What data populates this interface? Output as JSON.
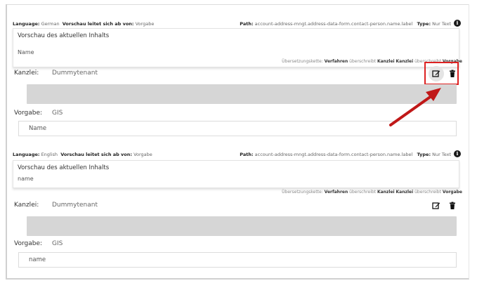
{
  "entries": [
    {
      "meta": {
        "language_label": "Language:",
        "language_value": "German",
        "redirect_label": "Vorschau leitet sich ab von:",
        "redirect_value": "Vorgabe",
        "path_label": "Path:",
        "path_value": "account-address-mngt.address-data-form.contact-person.name.label",
        "type_label": "Type:",
        "type_value": "Nur Text"
      },
      "preview": {
        "title": "Vorschau des aktuellen Inhalts",
        "value": "Name"
      },
      "chain": {
        "prefix": "Übersetzungskette:",
        "a": "Verfahren",
        "mid1": "überschreibt",
        "b": "Kanzlei",
        "c": "Kanzlei",
        "mid2": "überschreibt",
        "d": "Vorgabe"
      },
      "kanzlei": {
        "label": "Kanzlei:",
        "value": "Dummytenant"
      },
      "vorgabe": {
        "label": "Vorgabe:",
        "value": "GIS",
        "field_value": "Name"
      }
    },
    {
      "meta": {
        "language_label": "Language:",
        "language_value": "English",
        "redirect_label": "Vorschau leitet sich ab von:",
        "redirect_value": "Vorgabe",
        "path_label": "Path:",
        "path_value": "account-address-mngt.address-data-form.contact-person.name.label",
        "type_label": "Type:",
        "type_value": "Nur Text"
      },
      "preview": {
        "title": "Vorschau des aktuellen Inhalts",
        "value": "name"
      },
      "chain": {
        "prefix": "Übersetzungskette:",
        "a": "Verfahren",
        "mid1": "überschreibt",
        "b": "Kanzlei",
        "c": "Kanzlei",
        "mid2": "überschreibt",
        "d": "Vorgabe"
      },
      "kanzlei": {
        "label": "Kanzlei:",
        "value": "Dummytenant"
      },
      "vorgabe": {
        "label": "Vorgabe:",
        "value": "GIS",
        "field_value": "name"
      }
    }
  ],
  "icons": {
    "info": "i",
    "edit": "edit-icon",
    "delete": "trash-icon"
  },
  "colors": {
    "highlight": "#dd2222",
    "arrow": "#c01818",
    "grey_box": "#d6d6d6"
  }
}
